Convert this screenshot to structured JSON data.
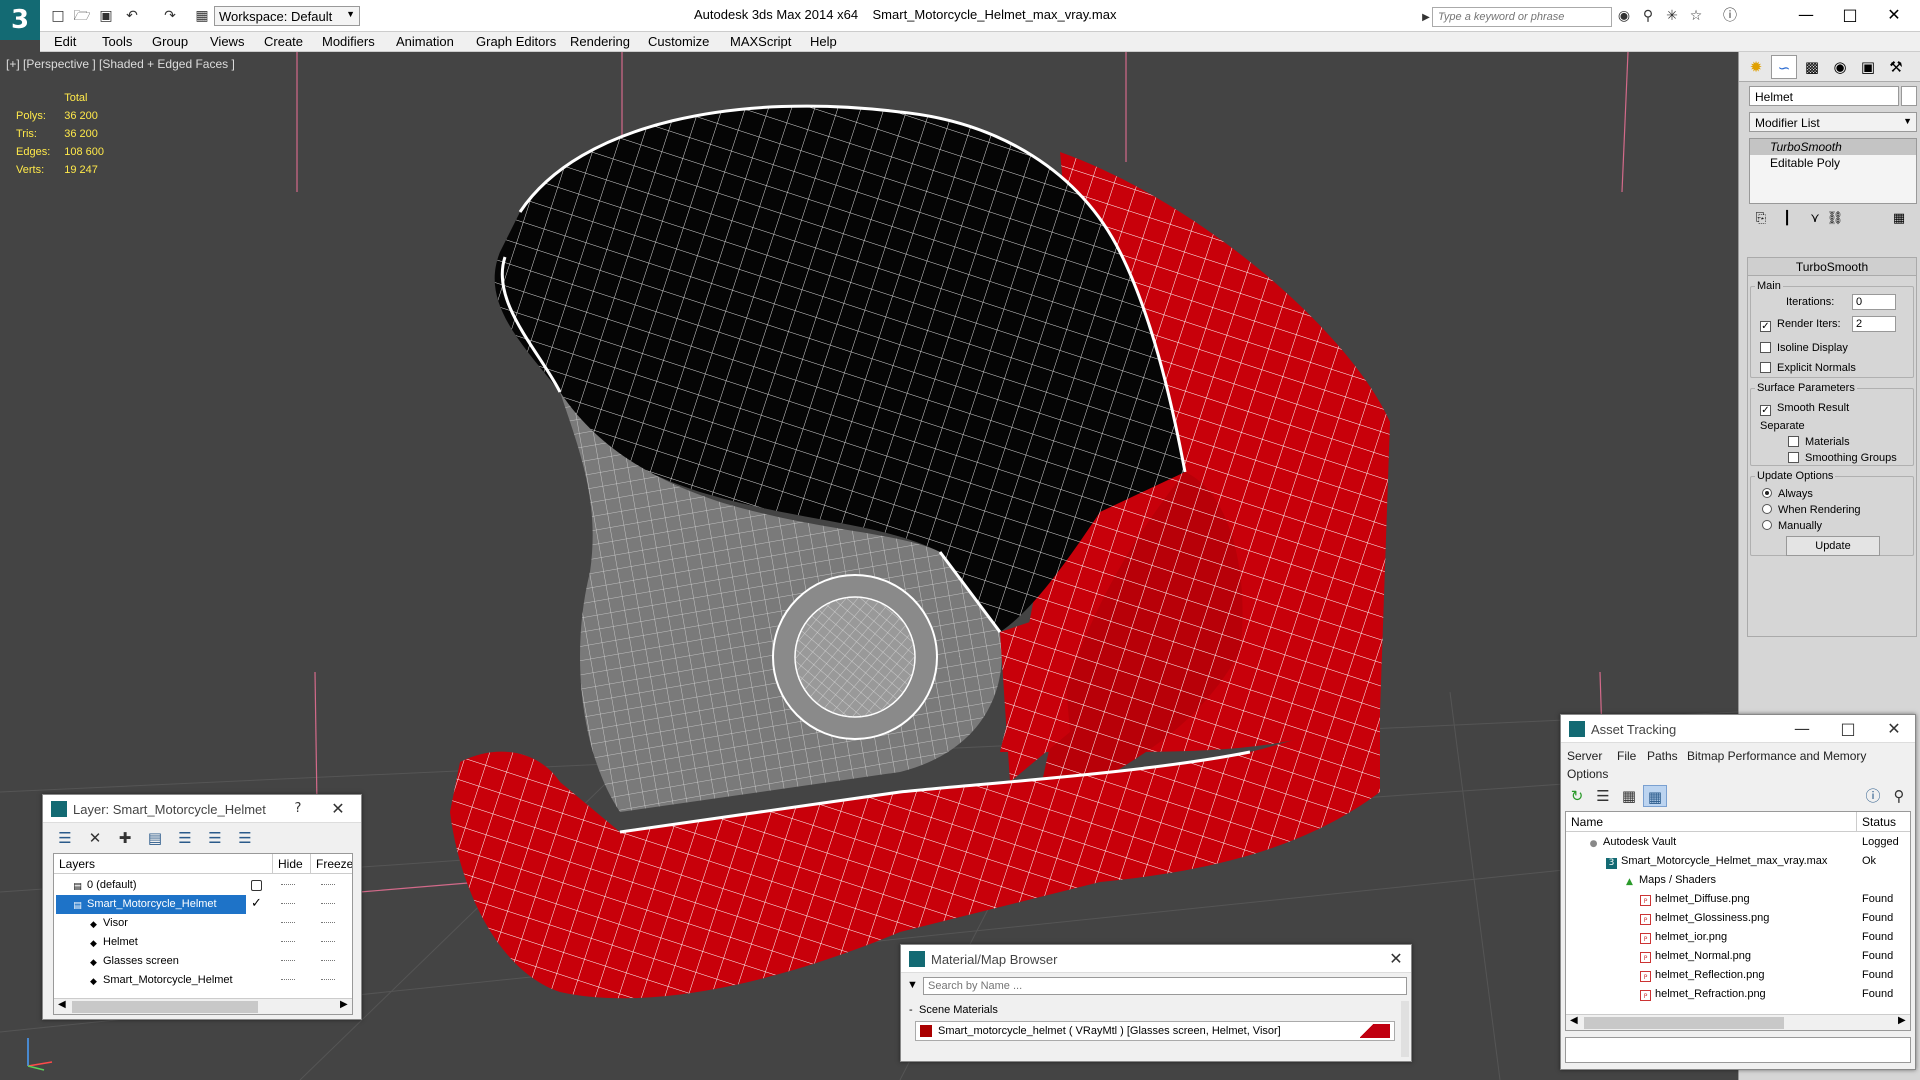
{
  "titlebar": {
    "app_title": "Autodesk 3ds Max  2014 x64",
    "file_name": "Smart_Motorcycle_Helmet_max_vray.max",
    "workspace": "Workspace: Default",
    "search_placeholder": "Type a keyword or phrase"
  },
  "menu": [
    "Edit",
    "Tools",
    "Group",
    "Views",
    "Create",
    "Modifiers",
    "Animation",
    "Graph Editors",
    "Rendering",
    "Customize",
    "MAXScript",
    "Help"
  ],
  "viewport": {
    "label": "[+] [Perspective ] [Shaded + Edged Faces ]",
    "stats_header": "Total",
    "stats": [
      {
        "label": "Polys:",
        "value": "36 200"
      },
      {
        "label": "Tris:",
        "value": "36 200"
      },
      {
        "label": "Edges:",
        "value": "108 600"
      },
      {
        "label": "Verts:",
        "value": "19 247"
      }
    ],
    "colors": {
      "helmet_red": "#c8000a",
      "wire": "#ffffff",
      "background": "#444444"
    }
  },
  "command_panel": {
    "object_name": "Helmet",
    "modifier_list": "Modifier List",
    "stack": [
      "TurboSmooth",
      "Editable Poly"
    ],
    "rollout_title": "TurboSmooth",
    "main_group": "Main",
    "iterations_label": "Iterations:",
    "iterations_value": "0",
    "render_iters_label": "Render Iters:",
    "render_iters_value": "2",
    "isoline": "Isoline Display",
    "explicit": "Explicit Normals",
    "surface_group": "Surface Parameters",
    "smooth_result": "Smooth Result",
    "separate": "Separate",
    "materials": "Materials",
    "smoothing_groups": "Smoothing Groups",
    "update_group": "Update Options",
    "always": "Always",
    "when_rendering": "When Rendering",
    "manually": "Manually",
    "update_btn": "Update"
  },
  "layer_window": {
    "title": "Layer: Smart_Motorcycle_Helmet",
    "help": "?",
    "col_layers": "Layers",
    "col_hide": "Hide",
    "col_freeze": "Freeze",
    "rows": [
      {
        "name": "0 (default)",
        "indent": 0,
        "selected": false
      },
      {
        "name": "Smart_Motorcycle_Helmet",
        "indent": 0,
        "selected": true
      },
      {
        "name": "Visor",
        "indent": 1,
        "selected": false
      },
      {
        "name": "Helmet",
        "indent": 1,
        "selected": false
      },
      {
        "name": "Glasses screen",
        "indent": 1,
        "selected": false
      },
      {
        "name": "Smart_Motorcycle_Helmet",
        "indent": 1,
        "selected": false
      }
    ]
  },
  "asset_tracking": {
    "title": "Asset Tracking",
    "menu": [
      "Server",
      "File",
      "Paths",
      "Bitmap Performance and Memory",
      "Options"
    ],
    "col_name": "Name",
    "col_status": "Status",
    "rows": [
      {
        "name": "Autodesk Vault",
        "status": "Logged",
        "indent": 1
      },
      {
        "name": "Smart_Motorcycle_Helmet_max_vray.max",
        "status": "Ok",
        "indent": 2
      },
      {
        "name": "Maps / Shaders",
        "status": "",
        "indent": 3
      },
      {
        "name": "helmet_Diffuse.png",
        "status": "Found",
        "indent": 4
      },
      {
        "name": "helmet_Glossiness.png",
        "status": "Found",
        "indent": 4
      },
      {
        "name": "helmet_ior.png",
        "status": "Found",
        "indent": 4
      },
      {
        "name": "helmet_Normal.png",
        "status": "Found",
        "indent": 4
      },
      {
        "name": "helmet_Reflection.png",
        "status": "Found",
        "indent": 4
      },
      {
        "name": "helmet_Refraction.png",
        "status": "Found",
        "indent": 4
      }
    ]
  },
  "material_browser": {
    "title": "Material/Map Browser",
    "search": "Search by Name ...",
    "section": "Scene Materials",
    "item": "Smart_motorcycle_helmet  ( VRayMtl )  [Glasses screen, Helmet, Visor]",
    "swatch_color": "#c00010"
  }
}
